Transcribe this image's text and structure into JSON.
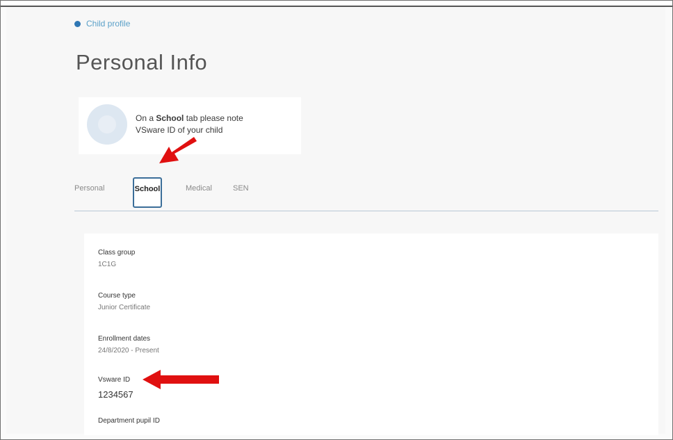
{
  "breadcrumb": {
    "label": "Child profile",
    "accent": "#2f77b4"
  },
  "page": {
    "title": "Personal Info"
  },
  "info_card": {
    "line1_prefix": "On a ",
    "line1_bold": "School",
    "line1_suffix": " tab please note",
    "line2": "VSware ID of your child"
  },
  "tabs": [
    {
      "label": "Personal",
      "active": false
    },
    {
      "label": "School",
      "active": true
    },
    {
      "label": "Medical",
      "active": false
    },
    {
      "label": "SEN",
      "active": false
    }
  ],
  "fields": [
    {
      "label": "Class group",
      "value": "1C1G"
    },
    {
      "label": "Course type",
      "value": "Junior Certificate"
    },
    {
      "label": "Enrollment dates",
      "value": "24/8/2020 - Present"
    },
    {
      "label": "Vsware ID",
      "value": "1234567"
    },
    {
      "label": "Department pupil ID",
      "value": ""
    }
  ],
  "annotation": {
    "arrow_color": "#e01010"
  }
}
